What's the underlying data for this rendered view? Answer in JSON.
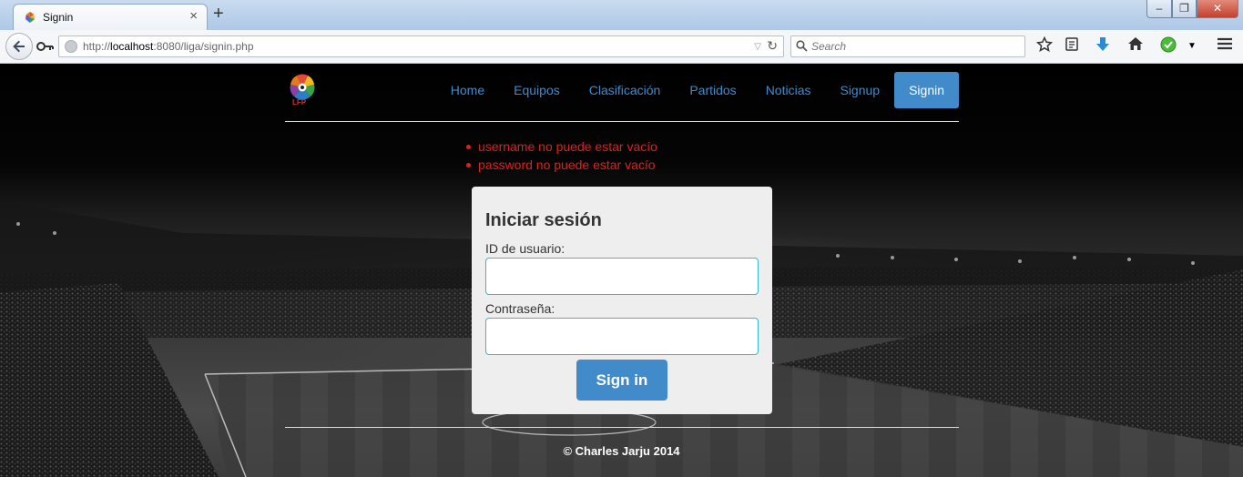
{
  "browser": {
    "tab_title": "Signin",
    "tab_close": "×",
    "new_tab": "+",
    "window_controls": {
      "minimize": "–",
      "maximize": "❐",
      "close": "✕"
    },
    "url": {
      "prefix": "http://",
      "host": "localhost",
      "rest": ":8080/liga/signin.php"
    },
    "url_dropmarker": "▽",
    "reload": "↻",
    "search_placeholder": "Search",
    "toolbar_icons": [
      "bookmark-star-icon",
      "reading-list-icon",
      "download-icon",
      "home-icon",
      "addon-check-icon",
      "menu-icon"
    ]
  },
  "site": {
    "logo_text": "LFP",
    "nav": [
      {
        "label": "Home"
      },
      {
        "label": "Equipos"
      },
      {
        "label": "Clasificación"
      },
      {
        "label": "Partidos"
      },
      {
        "label": "Noticias"
      },
      {
        "label": "Signup"
      },
      {
        "label": "Signin",
        "active": true
      }
    ],
    "errors": [
      "username no puede estar vacío",
      "password no puede estar vacío"
    ],
    "login": {
      "title": "Iniciar sesión",
      "username_label": "ID de usuario:",
      "username_value": "",
      "password_label": "Contraseña:",
      "password_value": "",
      "submit_label": "Sign in"
    },
    "footer": "© Charles Jarju 2014"
  },
  "colors": {
    "accent": "#428bca",
    "nav_link": "#3d8bd1",
    "error": "#e0201a",
    "input_border": "#35b9d6",
    "panel_bg": "#eeeeee"
  }
}
